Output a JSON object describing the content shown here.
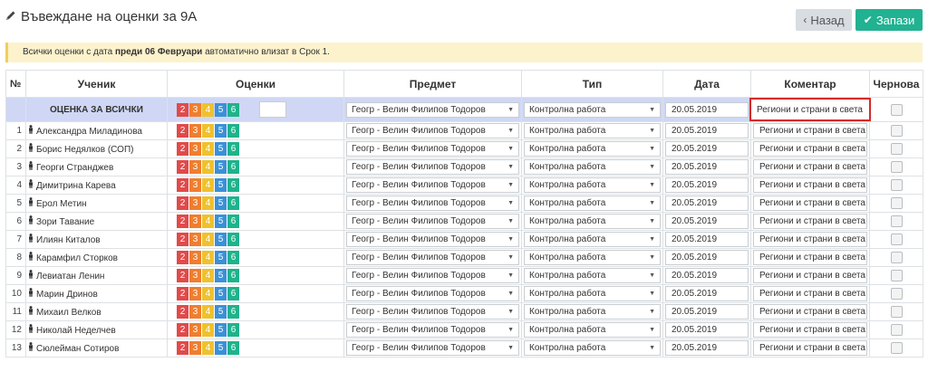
{
  "page": {
    "title": "Въвеждане на оценки за 9А"
  },
  "buttons": {
    "back": "Назад",
    "save": "Запази"
  },
  "notice": {
    "prefix": "Всички оценки с дата ",
    "bold": "преди 06 Февруари",
    "suffix": " автоматично влизат в Срок 1."
  },
  "table": {
    "headers": {
      "no": "№",
      "student": "Ученик",
      "grades": "Оценки",
      "subject": "Предмет",
      "type": "Тип",
      "date": "Дата",
      "comment": "Коментар",
      "draft": "Чернова"
    },
    "all_row": {
      "label": "ОЦЕНКА ЗА ВСИЧКИ"
    },
    "grade_buttons": [
      "2",
      "3",
      "4",
      "5",
      "6"
    ],
    "subject_value": "Геогр - Велин Филипов Тодоров",
    "type_value": "Контролна работа",
    "date_value": "20.05.2019",
    "comment_value": "Региони и страни в света",
    "students": [
      {
        "n": "1",
        "name": "Александра Миладинова"
      },
      {
        "n": "2",
        "name": "Борис Недялков (СОП)"
      },
      {
        "n": "3",
        "name": "Георги Странджев"
      },
      {
        "n": "4",
        "name": "Димитрина Карева"
      },
      {
        "n": "5",
        "name": "Ерол Метин"
      },
      {
        "n": "6",
        "name": "Зори Тавание"
      },
      {
        "n": "7",
        "name": "Илиян Киталов"
      },
      {
        "n": "8",
        "name": "Карамфил Сторков"
      },
      {
        "n": "9",
        "name": "Левиатан Ленин"
      },
      {
        "n": "10",
        "name": "Марин Дринов"
      },
      {
        "n": "11",
        "name": "Михаил Велков"
      },
      {
        "n": "12",
        "name": "Николай Неделчев"
      },
      {
        "n": "13",
        "name": "Сюлейман Сотиров"
      }
    ]
  },
  "icons": {
    "title": "pencil-icon",
    "back": "chevron-left-icon",
    "save": "check-icon",
    "student": "person-icon"
  },
  "colors": {
    "grade2": "#e14a4a",
    "grade3": "#ef7e2f",
    "grade4": "#efc12d",
    "grade5": "#3a91d7",
    "grade6": "#1eb38b",
    "save": "#21b291",
    "highlight": "#d42a2a"
  }
}
